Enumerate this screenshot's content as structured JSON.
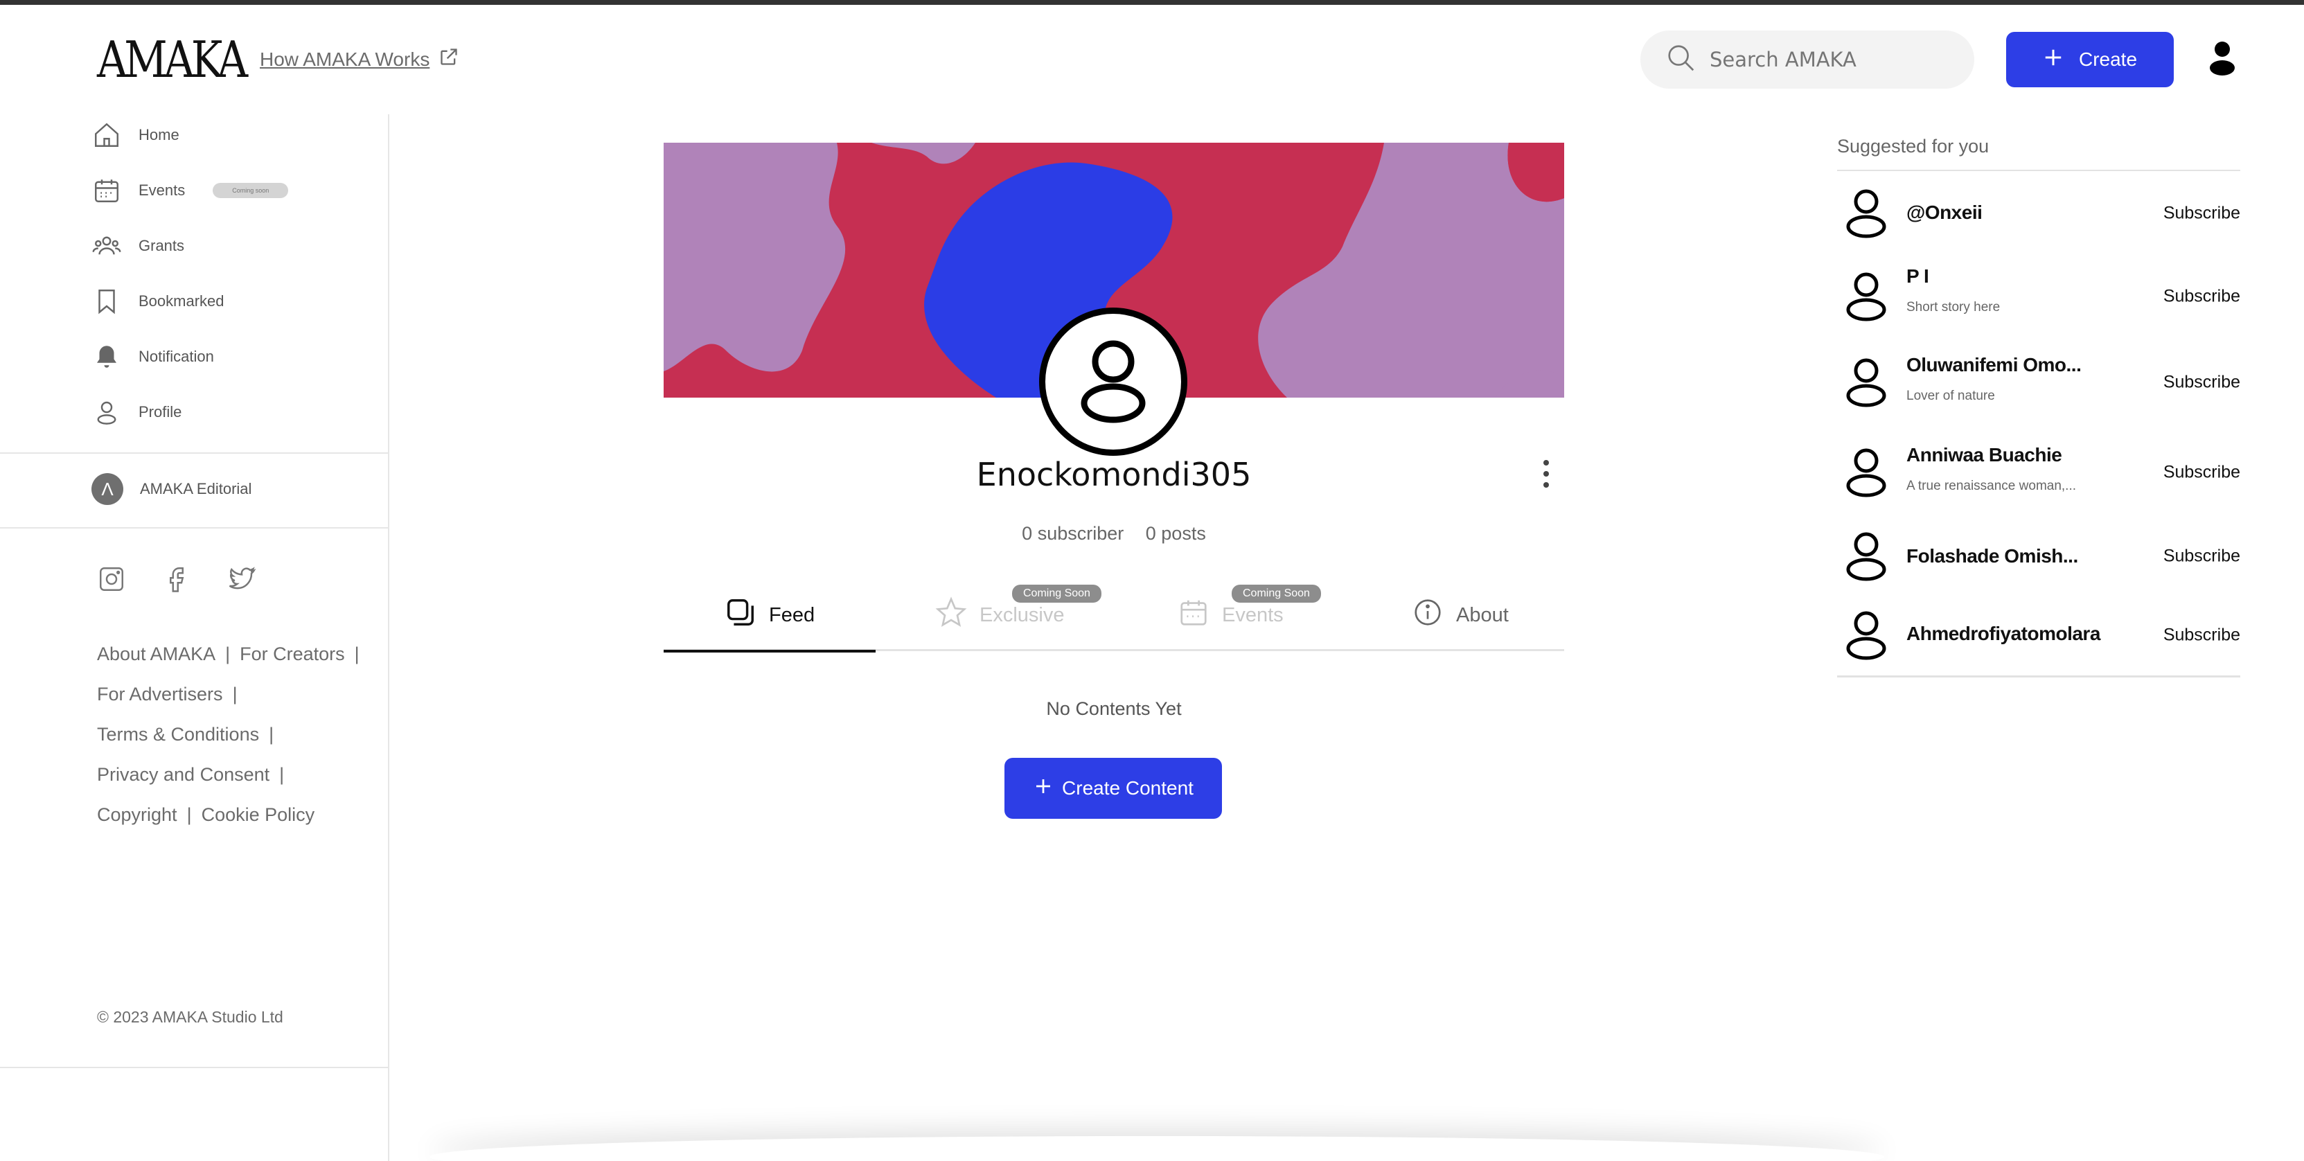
{
  "header": {
    "logo": "AMAKA",
    "how_link": "How AMAKA Works",
    "search_placeholder": "Search AMAKA",
    "create_label": "Create"
  },
  "sidebar": {
    "items": [
      {
        "label": "Home",
        "icon": "home-icon"
      },
      {
        "label": "Events",
        "icon": "calendar-icon",
        "badge": "Coming soon"
      },
      {
        "label": "Grants",
        "icon": "users-icon"
      },
      {
        "label": "Bookmarked",
        "icon": "bookmark-icon"
      },
      {
        "label": "Notification",
        "icon": "bell-icon"
      },
      {
        "label": "Profile",
        "icon": "user-icon"
      }
    ],
    "editorial": {
      "label": "AMAKA Editorial",
      "badge_letter": "Λ"
    },
    "socials": [
      "instagram-icon",
      "facebook-icon",
      "twitter-icon"
    ],
    "footer_links": [
      "About AMAKA",
      "For Creators",
      "For Advertisers",
      "Terms & Conditions",
      "Privacy and Consent",
      "Copyright",
      "Cookie Policy"
    ],
    "copyright": "© 2023 AMAKA Studio Ltd"
  },
  "profile": {
    "username": "Enockomondi305",
    "subscribers": "0 subscriber",
    "posts": "0 posts",
    "banner_colors": {
      "base": "#c62f52",
      "blob_light": "#b083b9",
      "blob_blue": "#2b3de6"
    },
    "tabs": [
      {
        "label": "Feed",
        "active": true
      },
      {
        "label": "Exclusive",
        "badge": "Coming Soon",
        "disabled": true
      },
      {
        "label": "Events",
        "badge": "Coming Soon",
        "disabled": true
      },
      {
        "label": "About"
      }
    ],
    "empty_text": "No Contents Yet",
    "create_content_label": "Create Content"
  },
  "suggestions": {
    "title": "Suggested for you",
    "subscribe_label": "Subscribe",
    "people": [
      {
        "name": "@Onxeii",
        "bio": ""
      },
      {
        "name": "P I",
        "bio": "Short story here"
      },
      {
        "name": "Oluwanifemi Omo...",
        "bio": "Lover of nature"
      },
      {
        "name": "Anniwaa Buachie",
        "bio": "A true renaissance woman,..."
      },
      {
        "name": "Folashade Omish...",
        "bio": ""
      },
      {
        "name": "Ahmedrofiyatomolara",
        "bio": ""
      }
    ]
  },
  "colors": {
    "accent": "#2d3ee6",
    "text_muted": "#6b6b6b"
  }
}
